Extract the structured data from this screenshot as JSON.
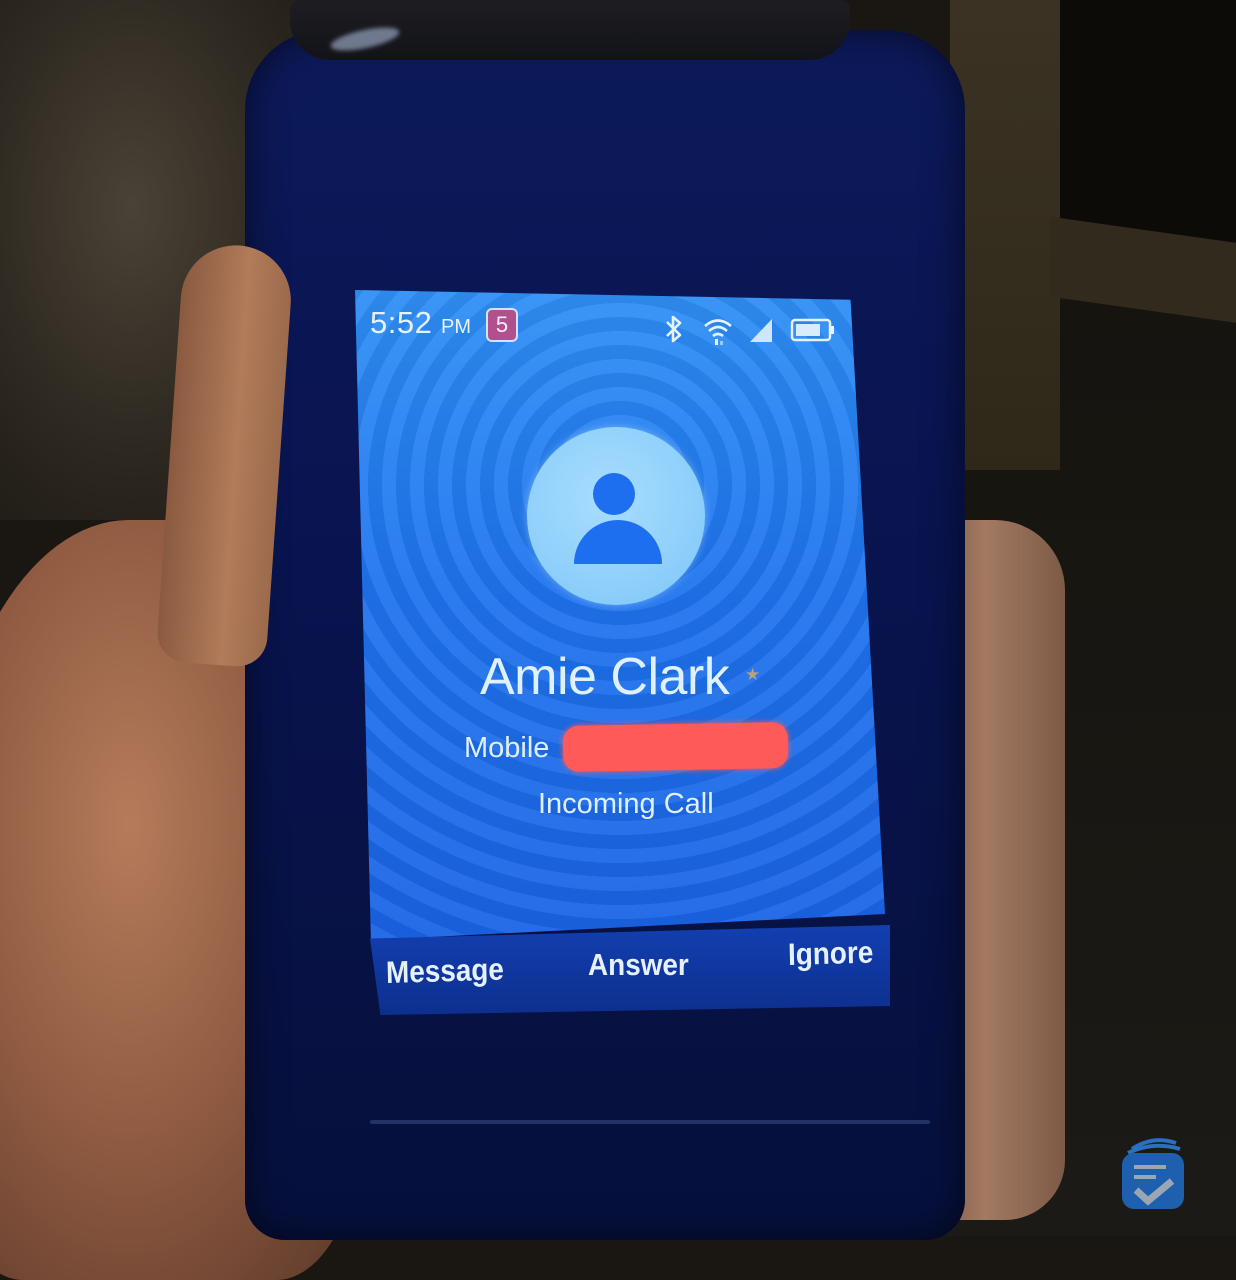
{
  "status_bar": {
    "time": "5:52",
    "ampm": "PM",
    "notification_badge": "5",
    "badge_color": "#b2508e",
    "icons": [
      "bluetooth-icon",
      "wifi-icon",
      "cellular-signal-icon",
      "battery-icon"
    ]
  },
  "call": {
    "contact_name": "Amie Clark",
    "favorite_indicator": "★",
    "number_label": "Mobile",
    "number_value": "[redacted]",
    "status": "Incoming Call",
    "avatar_icon": "person-icon"
  },
  "softkeys": {
    "left": "Message",
    "center": "Answer",
    "right": "Ignore"
  },
  "colors": {
    "screen_bg": "#1f74ee",
    "text": "#dff1ff",
    "redaction": "#ff5a5a",
    "phone_body": "#091450"
  },
  "watermark": {
    "icon": "checklist-logo-icon"
  }
}
